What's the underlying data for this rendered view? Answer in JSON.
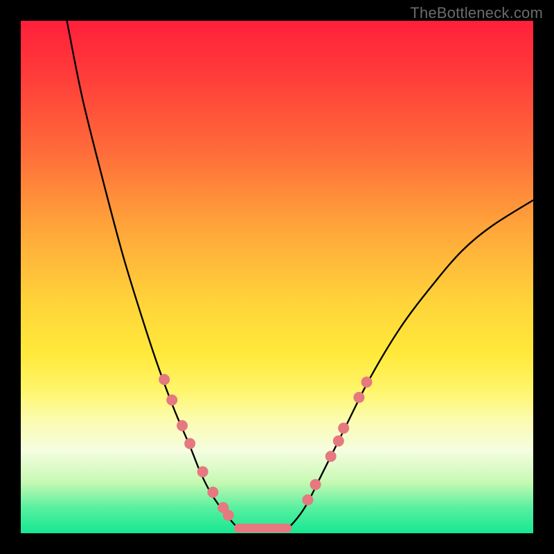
{
  "watermark": "TheBottleneck.com",
  "colors": {
    "frame": "#000000",
    "curve": "#000000",
    "dot": "#e6787f",
    "gradient_top": "#ff1f3a",
    "gradient_bottom": "#16e892"
  },
  "chart_data": {
    "type": "line",
    "title": "",
    "xlabel": "",
    "ylabel": "",
    "xlim": [
      0,
      100
    ],
    "ylim": [
      0,
      100
    ],
    "note": "Axes unlabeled; values are percentage of plot span, read from pixel positions. y grows downward in the image but is reported here with 0 at bottom (chart convention).",
    "series": [
      {
        "name": "left-branch",
        "x": [
          9,
          12,
          16,
          20,
          24,
          27,
          30,
          33,
          35,
          37,
          39,
          41,
          42.5
        ],
        "y": [
          100,
          85,
          69,
          54,
          41,
          32,
          24,
          17,
          12,
          8,
          5,
          2.5,
          1
        ]
      },
      {
        "name": "flat-bottom",
        "x": [
          42.5,
          44,
          46,
          48,
          50,
          52
        ],
        "y": [
          1,
          0.9,
          0.8,
          0.8,
          0.9,
          1
        ]
      },
      {
        "name": "right-branch",
        "x": [
          52,
          54,
          56,
          59,
          63,
          68,
          74,
          80,
          86,
          92,
          100
        ],
        "y": [
          1,
          3,
          6,
          12,
          20,
          30,
          40,
          48,
          55,
          60,
          65
        ]
      }
    ],
    "markers": {
      "name": "highlighted-points",
      "points": [
        {
          "x": 28.0,
          "y": 30.0
        },
        {
          "x": 29.5,
          "y": 26.0
        },
        {
          "x": 31.5,
          "y": 21.0
        },
        {
          "x": 33.0,
          "y": 17.5
        },
        {
          "x": 35.5,
          "y": 12.0
        },
        {
          "x": 37.5,
          "y": 8.0
        },
        {
          "x": 39.5,
          "y": 5.0
        },
        {
          "x": 40.5,
          "y": 3.5
        },
        {
          "x": 56.0,
          "y": 6.5
        },
        {
          "x": 57.5,
          "y": 9.5
        },
        {
          "x": 60.5,
          "y": 15.0
        },
        {
          "x": 62.0,
          "y": 18.0
        },
        {
          "x": 63.0,
          "y": 20.5
        },
        {
          "x": 66.0,
          "y": 26.5
        },
        {
          "x": 67.5,
          "y": 29.5
        }
      ]
    },
    "flat_segment": {
      "x0": 42.5,
      "x1": 52.0,
      "y": 1.0
    }
  }
}
